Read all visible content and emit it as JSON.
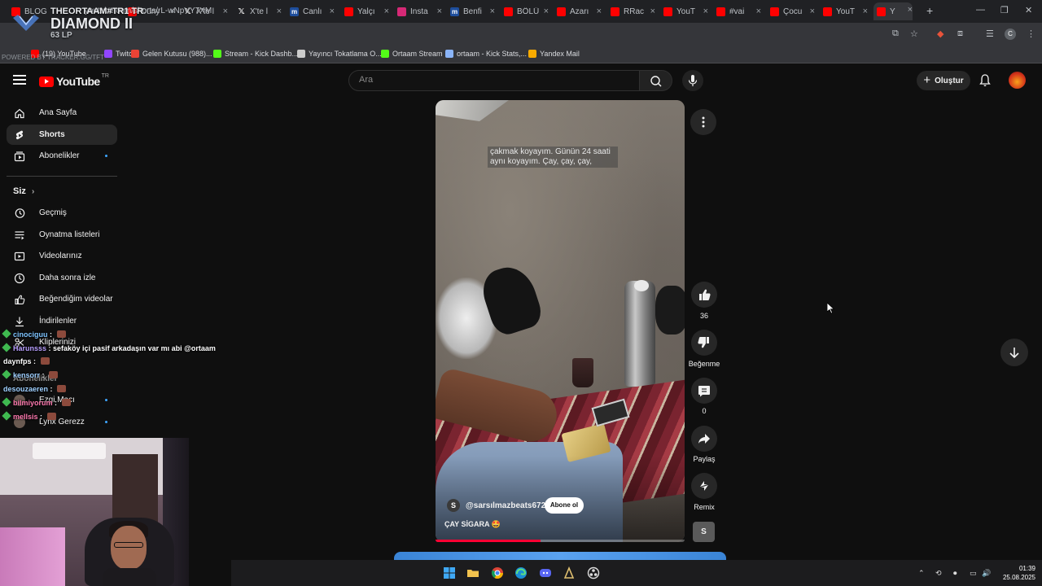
{
  "browser": {
    "tabs": [
      {
        "title": "BLOG",
        "icon": "youtube"
      },
      {
        "title": "Düny",
        "icon": "youtube"
      },
      {
        "title": "X'te l",
        "icon": "x"
      },
      {
        "title": "X'te l",
        "icon": "x"
      },
      {
        "title": "Canlı",
        "icon": "m"
      },
      {
        "title": "Yalçı",
        "icon": "youtube"
      },
      {
        "title": "Insta",
        "icon": "instagram"
      },
      {
        "title": "Benfi",
        "icon": "m"
      },
      {
        "title": "BÖLÜ",
        "icon": "youtube"
      },
      {
        "title": "Azarı",
        "icon": "youtube"
      },
      {
        "title": "RRac",
        "icon": "youtube"
      },
      {
        "title": "YouT",
        "icon": "youtube"
      },
      {
        "title": "#vai",
        "icon": "youtube"
      },
      {
        "title": "Çocu",
        "icon": "youtube"
      },
      {
        "title": "YouT",
        "icon": "youtube"
      },
      {
        "title": "Y",
        "icon": "youtube",
        "active": true
      }
    ],
    "url": "youtube.com/shorts/rL-wNpVY7XM",
    "bookmarks": [
      {
        "label": "(19) YouTube",
        "color": "#ff0000"
      },
      {
        "label": "Twitch",
        "color": "#9146ff"
      },
      {
        "label": "Gelen Kutusu (988)...",
        "color": "#ea4335"
      },
      {
        "label": "Stream - Kick Dashb...",
        "color": "#53fc18"
      },
      {
        "label": "Yayıncı Tokatlama O...",
        "color": "#cccccc"
      },
      {
        "label": "Ortaam Stream",
        "color": "#53fc18"
      },
      {
        "label": "ortaam - Kick Stats,...",
        "color": "#8ab4f8"
      },
      {
        "label": "Yandex Mail",
        "color": "#f9ab00"
      }
    ]
  },
  "stream_overlay": {
    "player": "THEORTAAM#TR1 TR",
    "rank": "DIAMOND II",
    "lp": "63 LP",
    "powered": "POWERED BY TRACKER.GG/TFT"
  },
  "youtube": {
    "logo_text": "YouTube",
    "logo_region": "TR",
    "search_placeholder": "Ara",
    "create_label": "Oluştur",
    "sidebar": {
      "items": [
        {
          "label": "Ana Sayfa",
          "icon": "home-icon"
        },
        {
          "label": "Shorts",
          "icon": "shorts-icon",
          "active": true
        },
        {
          "label": "Abonelikler",
          "icon": "subscriptions-icon",
          "dot": true
        }
      ],
      "you_label": "Siz",
      "you_items": [
        {
          "label": "Geçmiş",
          "icon": "history-icon"
        },
        {
          "label": "Oynatma listeleri",
          "icon": "playlists-icon"
        },
        {
          "label": "Videolarınız",
          "icon": "your-videos-icon"
        },
        {
          "label": "Daha sonra izle",
          "icon": "watch-later-icon"
        },
        {
          "label": "Beğendiğim videolar",
          "icon": "liked-icon"
        },
        {
          "label": "İndirilenler",
          "icon": "downloads-icon"
        },
        {
          "label": "Kliplerinizi",
          "icon": "clips-icon"
        }
      ],
      "subs_label": "Abonelikler",
      "subs": [
        {
          "label": "Ezgi Macı",
          "dot": true
        },
        {
          "label": "Lynx Gerezz",
          "dot": true
        }
      ]
    },
    "short": {
      "caption": "çakmak koyayım. Günün 24 saati aynı koyayım. Çay, çay, çay,",
      "channel_initial": "S",
      "channel": "@sarsılmazbeats6727",
      "subscribe_label": "Abone ol",
      "title": "ÇAY SİGARA 🤩",
      "progress": 0.42,
      "likes": "36",
      "dislike_label": "Beğenme",
      "comments": "0",
      "share_label": "Paylaş",
      "remix_label": "Remix",
      "sound_initial": "S"
    }
  },
  "chat": [
    {
      "user": "cinociguu",
      "text": ""
    },
    {
      "user": "Harunsss",
      "text": "sefaköy içi pasif arkadaşın var mı abi @ortaam"
    },
    {
      "user": "daynfps",
      "text": ""
    },
    {
      "user": "kensorr",
      "text": ""
    },
    {
      "user": "desouzaeren",
      "text": ""
    },
    {
      "user": "bilmiyorum",
      "text": ""
    },
    {
      "user": "mellsis",
      "text": ""
    }
  ],
  "taskbar": {
    "time": "01:39",
    "date": "25.08.2025"
  }
}
